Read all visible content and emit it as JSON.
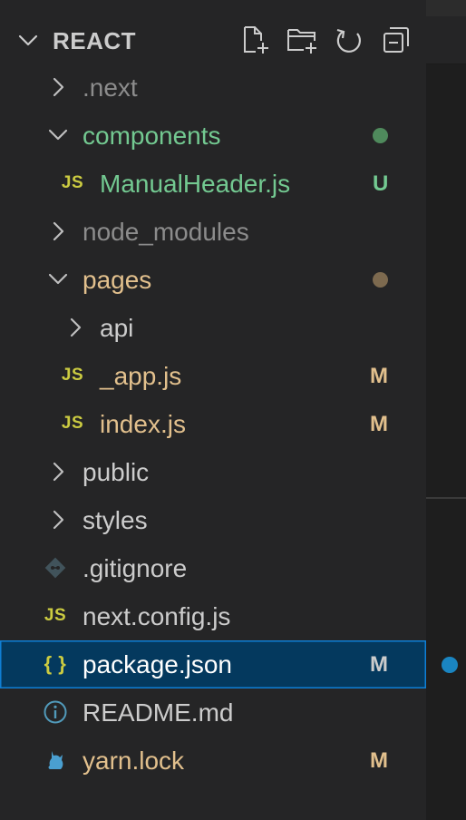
{
  "explorer": {
    "title": "REACT",
    "actions": [
      {
        "name": "new-file-icon"
      },
      {
        "name": "new-folder-icon"
      },
      {
        "name": "refresh-icon"
      },
      {
        "name": "collapse-all-icon"
      }
    ],
    "tree": [
      {
        "label": ".next",
        "type": "folder",
        "expanded": false,
        "depth": 0,
        "color": "#8c8c8c",
        "badge": "",
        "badge_color": ""
      },
      {
        "label": "components",
        "type": "folder",
        "expanded": true,
        "depth": 0,
        "color": "#73c991",
        "badge": "dot",
        "badge_color": "#4f8a5c"
      },
      {
        "label": "ManualHeader.js",
        "type": "js",
        "depth": 1,
        "color": "#73c991",
        "badge": "U",
        "badge_color": "#73c991"
      },
      {
        "label": "node_modules",
        "type": "folder",
        "expanded": false,
        "depth": 0,
        "color": "#8c8c8c",
        "badge": "",
        "badge_color": ""
      },
      {
        "label": "pages",
        "type": "folder",
        "expanded": true,
        "depth": 0,
        "color": "#e2c08d",
        "badge": "dot",
        "badge_color": "#7d6a4f"
      },
      {
        "label": "api",
        "type": "folder",
        "expanded": false,
        "depth": 1,
        "color": "#cccccc",
        "badge": "",
        "badge_color": ""
      },
      {
        "label": "_app.js",
        "type": "js",
        "depth": 1,
        "color": "#e2c08d",
        "badge": "M",
        "badge_color": "#e2c08d"
      },
      {
        "label": "index.js",
        "type": "js",
        "depth": 1,
        "color": "#e2c08d",
        "badge": "M",
        "badge_color": "#e2c08d"
      },
      {
        "label": "public",
        "type": "folder",
        "expanded": false,
        "depth": 0,
        "color": "#cccccc",
        "badge": "",
        "badge_color": ""
      },
      {
        "label": "styles",
        "type": "folder",
        "expanded": false,
        "depth": 0,
        "color": "#cccccc",
        "badge": "",
        "badge_color": ""
      },
      {
        "label": ".gitignore",
        "type": "git",
        "depth": 0,
        "color": "#cccccc",
        "badge": "",
        "badge_color": ""
      },
      {
        "label": "next.config.js",
        "type": "js",
        "depth": 0,
        "color": "#cccccc",
        "badge": "",
        "badge_color": ""
      },
      {
        "label": "package.json",
        "type": "json",
        "depth": 0,
        "color": "#ffffff",
        "badge": "M",
        "badge_color": "#cccccc",
        "selected": true
      },
      {
        "label": "README.md",
        "type": "info",
        "depth": 0,
        "color": "#cccccc",
        "badge": "",
        "badge_color": ""
      },
      {
        "label": "yarn.lock",
        "type": "yarn",
        "depth": 0,
        "color": "#e2c08d",
        "badge": "M",
        "badge_color": "#e2c08d"
      }
    ],
    "js_icon_text": "JS",
    "json_icon_text": "{ }"
  },
  "colors": {
    "sidebar_bg": "#252526",
    "editor_bg": "#1e1e1e",
    "selection_bg": "#04395e",
    "selection_border": "#0f7fd5",
    "accent_dot": "#1a85c1"
  }
}
